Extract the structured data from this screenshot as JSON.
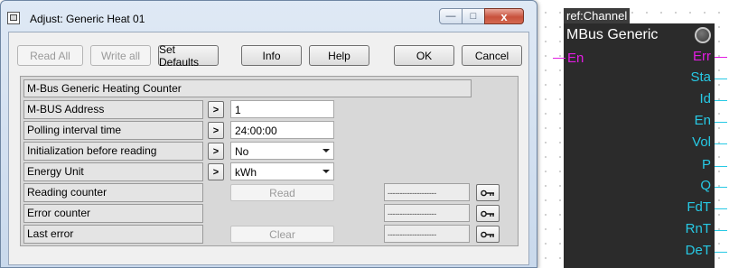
{
  "dialog": {
    "title": "Adjust: Generic Heat 01",
    "window_controls": {
      "minimize": "—",
      "maximize": "□",
      "close": "x"
    }
  },
  "toolbar": {
    "read_all": "Read All",
    "write_all": "Write all",
    "set_defaults": "Set Defaults",
    "info": "Info",
    "help": "Help",
    "ok": "OK",
    "cancel": "Cancel"
  },
  "panel": {
    "header": "M-Bus Generic Heating Counter",
    "rows": [
      {
        "label": "M-BUS Address",
        "value": "1"
      },
      {
        "label": "Polling interval time",
        "value": "24:00:00"
      },
      {
        "label": "Initialization before reading",
        "value": "No"
      },
      {
        "label": "Energy Unit",
        "value": "kWh"
      },
      {
        "label": "Reading counter",
        "button": "Read",
        "display": "--------------------"
      },
      {
        "label": "Error counter",
        "display": "--------------------"
      },
      {
        "label": "Last error",
        "button": "Clear",
        "display": "--------------------"
      }
    ],
    "arrow_symbol": ">"
  },
  "block": {
    "ref": "ref:Channel",
    "title": "MBus Generic",
    "input": "En",
    "outputs": [
      "Err",
      "Sta",
      "Id",
      "En",
      "Vol",
      "P",
      "Q",
      "FdT",
      "RnT",
      "DeT"
    ]
  },
  "colors": {
    "block_bg": "#2b2b2b",
    "input_pin": "#e21ce2",
    "output_pin": "#27c9e4",
    "error_pin": "#e21ce2"
  }
}
